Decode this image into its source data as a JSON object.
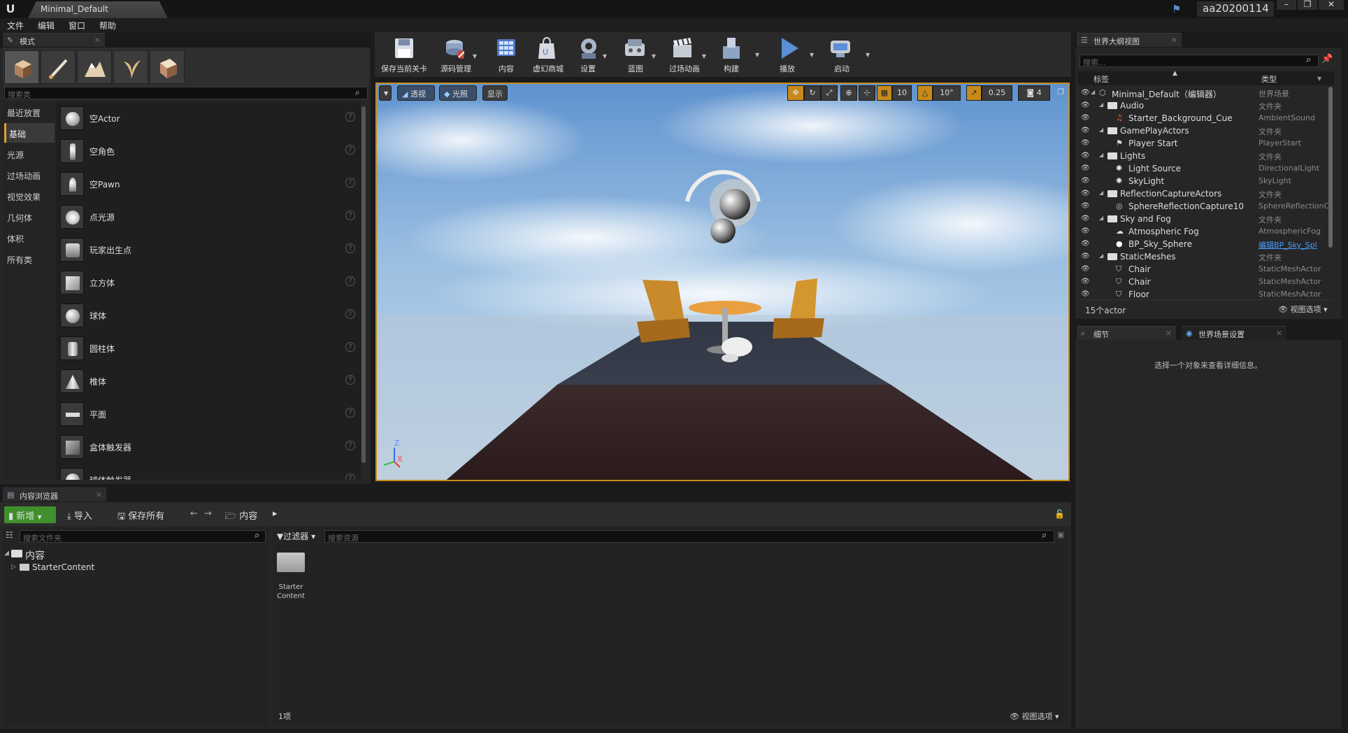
{
  "window": {
    "tab_title": "Minimal_Default",
    "user": "aa20200114"
  },
  "menu": [
    "文件",
    "编辑",
    "窗口",
    "帮助"
  ],
  "modes_panel": {
    "tab": "模式",
    "search_placeholder": "搜索类",
    "categories": [
      "最近放置",
      "基础",
      "光源",
      "过场动画",
      "视觉效果",
      "几何体",
      "体积",
      "所有类"
    ],
    "items": [
      "空Actor",
      "空角色",
      "空Pawn",
      "点光源",
      "玩家出生点",
      "立方体",
      "球体",
      "圆柱体",
      "椎体",
      "平面",
      "盒体触发器"
    ],
    "partial_item": "球体触发器"
  },
  "toolbar": {
    "save": "保存当前关卡",
    "source": "源码管理",
    "content": "内容",
    "market": "虚幻商城",
    "settings": "设置",
    "blueprint": "蓝图",
    "cinematics": "过场动画",
    "build": "构建",
    "play": "播放",
    "launch": "启动"
  },
  "viewport": {
    "perspective": "透视",
    "lit": "光照",
    "show": "显示",
    "grid_snap": "10",
    "rot_snap": "10°",
    "scale_snap": "0.25",
    "cam_speed": "4",
    "axis_z": "Z",
    "axis_x": "X"
  },
  "outliner": {
    "tab": "世界大纲视图",
    "search_placeholder": "搜索...",
    "col_label": "标签",
    "col_type": "类型",
    "rows": [
      {
        "name": "Minimal_Default（编辑器）",
        "type": "世界场景",
        "depth": 0,
        "icon": "world"
      },
      {
        "name": "Audio",
        "type": "文件夹",
        "depth": 1,
        "icon": "folder"
      },
      {
        "name": "Starter_Background_Cue",
        "type": "AmbientSound",
        "depth": 2,
        "icon": "sound"
      },
      {
        "name": "GamePlayActors",
        "type": "文件夹",
        "depth": 1,
        "icon": "folder"
      },
      {
        "name": "Player Start",
        "type": "PlayerStart",
        "depth": 2,
        "icon": "player"
      },
      {
        "name": "Lights",
        "type": "文件夹",
        "depth": 1,
        "icon": "folder"
      },
      {
        "name": "Light Source",
        "type": "DirectionalLight",
        "depth": 2,
        "icon": "light"
      },
      {
        "name": "SkyLight",
        "type": "SkyLight",
        "depth": 2,
        "icon": "light"
      },
      {
        "name": "ReflectionCaptureActors",
        "type": "文件夹",
        "depth": 1,
        "icon": "folder"
      },
      {
        "name": "SphereReflectionCapture10",
        "type": "SphereReflectionC",
        "depth": 2,
        "icon": "sphere"
      },
      {
        "name": "Sky and Fog",
        "type": "文件夹",
        "depth": 1,
        "icon": "folder"
      },
      {
        "name": "Atmospheric Fog",
        "type": "AtmosphericFog",
        "depth": 2,
        "icon": "fog"
      },
      {
        "name": "BP_Sky_Sphere",
        "type": "编辑BP_Sky_Spl",
        "depth": 2,
        "icon": "ball",
        "link": true
      },
      {
        "name": "StaticMeshes",
        "type": "文件夹",
        "depth": 1,
        "icon": "folder"
      },
      {
        "name": "Chair",
        "type": "StaticMeshActor",
        "depth": 2,
        "icon": "mesh"
      },
      {
        "name": "Chair",
        "type": "StaticMeshActor",
        "depth": 2,
        "icon": "mesh"
      },
      {
        "name": "Floor",
        "type": "StaticMeshActor",
        "depth": 2,
        "icon": "mesh"
      }
    ],
    "count": "15个actor",
    "view_options": "视图选项"
  },
  "details": {
    "tab_details": "细节",
    "tab_world": "世界场景设置",
    "empty_msg": "选择一个对象来查看详细信息。"
  },
  "content_browser": {
    "tab": "内容浏览器",
    "new": "新增",
    "import": "导入",
    "save_all": "保存所有",
    "path_root": "内容",
    "search_folders": "搜索文件夹",
    "filter": "过滤器",
    "search_assets": "搜索资源",
    "tree_root": "内容",
    "tree_child": "StarterContent",
    "asset_line1": "Starter",
    "asset_line2": "Content",
    "item_count": "1项",
    "view_options": "视图选项"
  }
}
